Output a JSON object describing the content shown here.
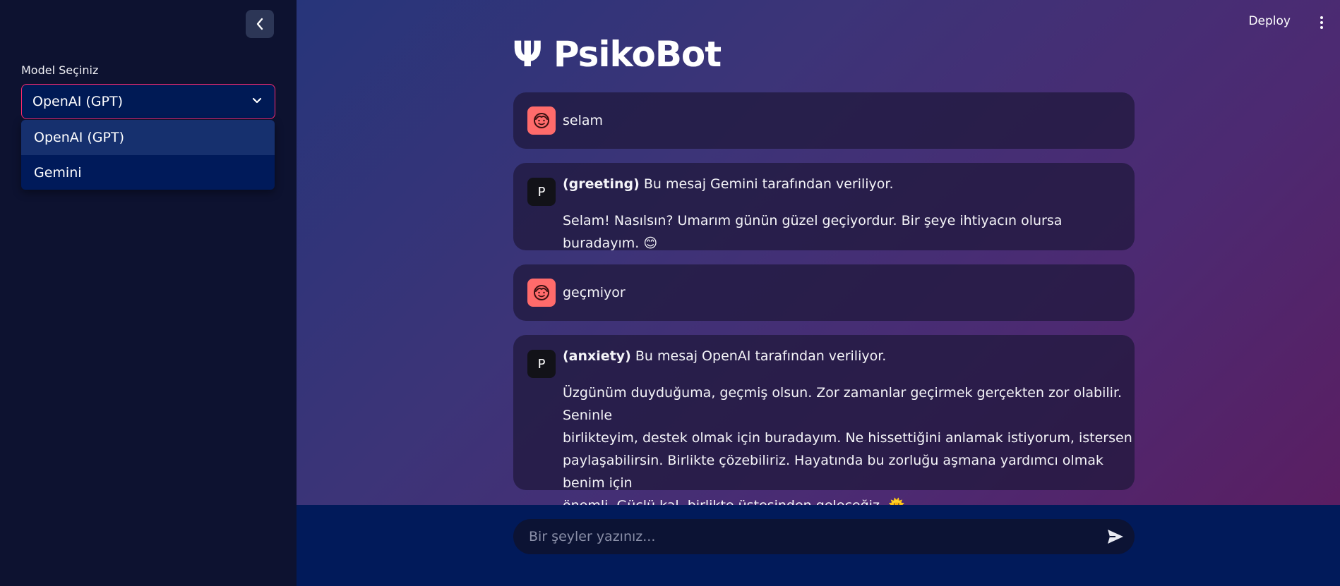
{
  "sidebar": {
    "model_label": "Model Seçiniz",
    "selected_model": "OpenAI (GPT)",
    "options": [
      "OpenAI (GPT)",
      "Gemini"
    ]
  },
  "header": {
    "deploy_label": "Deploy",
    "app_title": "Ψ PsikoBot"
  },
  "messages": [
    {
      "role": "user",
      "text": "selam"
    },
    {
      "role": "assistant",
      "avatar_letter": "P",
      "tag": "(greeting)",
      "source_note": " Bu mesaj Gemini tarafından veriliyor.",
      "body": "Selam! Nasılsın? Umarım günün güzel geçiyordur. Bir şeye ihtiyacın olursa buradayım. 😊"
    },
    {
      "role": "user",
      "text": "geçmiyor"
    },
    {
      "role": "assistant",
      "avatar_letter": "P",
      "tag": "(anxiety)",
      "source_note": " Bu mesaj OpenAI tarafından veriliyor.",
      "body_lines": [
        "Üzgünüm duyduğuma, geçmiş olsun. Zor zamanlar geçirmek gerçekten zor olabilir. Seninle",
        "birlikteyim, destek olmak için buradayım. Ne hissettiğini anlamak istiyorum, istersen",
        "paylaşabilirsin. Birlikte çözebiliriz. Hayatında bu zorluğu aşmana yardımcı olmak benim için",
        "önemli. Güçlü kal, birlikte üstesinden geleceğiz. 🌞"
      ]
    }
  ],
  "input": {
    "placeholder": "Bir şeyler yazınız..."
  },
  "colors": {
    "user_avatar": "#ff6b6b",
    "select_border": "#ff2a6e",
    "sidebar_bg": "#0d1230",
    "bottom_bg": "#011a5a"
  }
}
